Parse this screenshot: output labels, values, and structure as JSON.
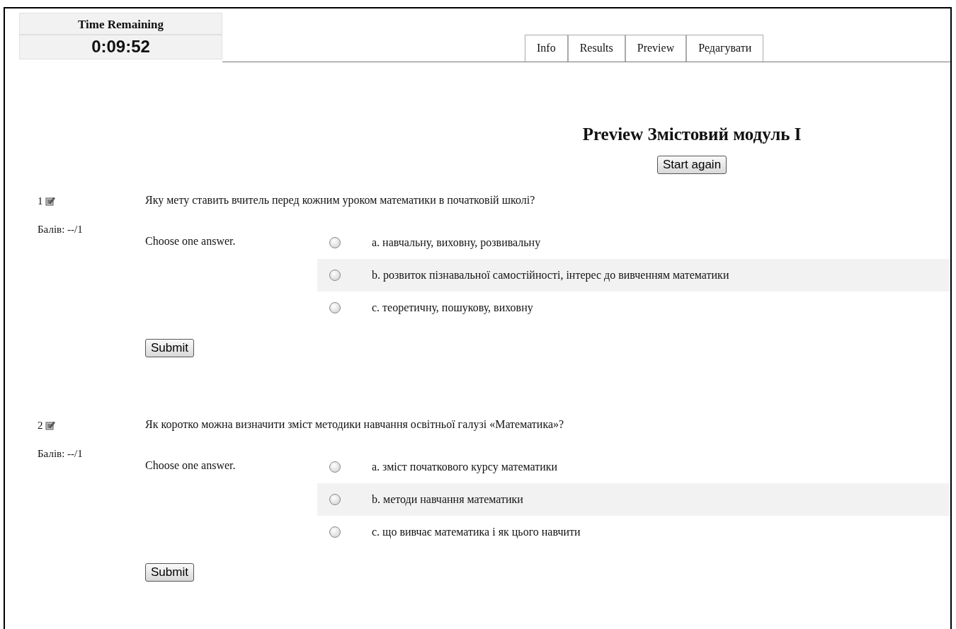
{
  "timer": {
    "title": "Time Remaining",
    "value": "0:09:52"
  },
  "tabs": [
    {
      "label": "Info",
      "selected": false
    },
    {
      "label": "Results",
      "selected": false
    },
    {
      "label": "Preview",
      "selected": false
    },
    {
      "label": "Редагувати",
      "selected": false
    }
  ],
  "heading": "Preview Змістовий модуль I",
  "start_button": "Start again",
  "questions": [
    {
      "number": "1",
      "text": "Яку мету ставить вчитель перед кожним уроком математики в початковій школі?",
      "grade": "Балів: --/1",
      "prompt": "Choose one answer.",
      "options": [
        {
          "label": "a. навчальну, виховну, розвивальну",
          "selected": false
        },
        {
          "label": "b. розвиток пізнавальної самостійності, інтерес до вивченням математики",
          "selected": false
        },
        {
          "label": "c. теоретичну, пошукову, виховну",
          "selected": false
        }
      ],
      "submit": "Submit"
    },
    {
      "number": "2",
      "text": "Як коротко можна визначити зміст методики навчання освітньої галузі «Математика»?",
      "grade": "Балів: --/1",
      "prompt": "Choose one answer.",
      "options": [
        {
          "label": "a. зміст початкового курсу математики",
          "selected": false
        },
        {
          "label": "b. методи навчання математики",
          "selected": false
        },
        {
          "label": "c. що вивчає математика і як цього навчити",
          "selected": false
        }
      ],
      "submit": "Submit"
    }
  ]
}
